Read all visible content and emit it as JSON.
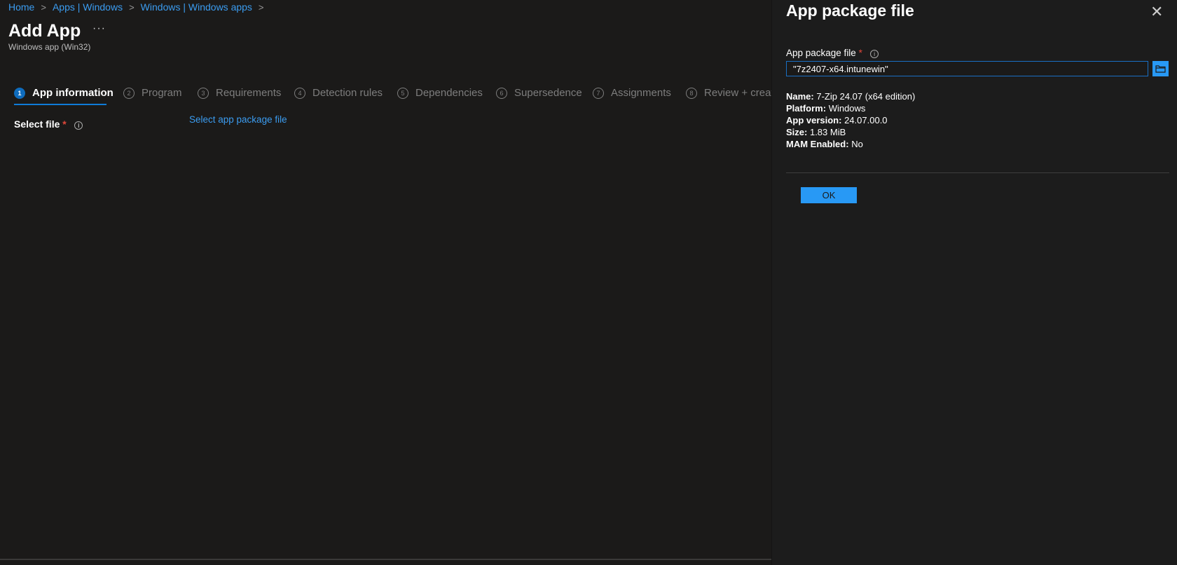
{
  "breadcrumb": [
    "Home",
    "Apps | Windows",
    "Windows | Windows apps"
  ],
  "header": {
    "title": "Add App",
    "more": "···",
    "subtitle": "Windows app (Win32)"
  },
  "steps": [
    {
      "num": "1",
      "label": "App information"
    },
    {
      "num": "2",
      "label": "Program"
    },
    {
      "num": "3",
      "label": "Requirements"
    },
    {
      "num": "4",
      "label": "Detection rules"
    },
    {
      "num": "5",
      "label": "Dependencies"
    },
    {
      "num": "6",
      "label": "Supersedence"
    },
    {
      "num": "7",
      "label": "Assignments"
    },
    {
      "num": "8",
      "label": "Review + create"
    }
  ],
  "form": {
    "select_file_label": "Select file",
    "required": "*",
    "info": "i",
    "select_link": "Select app package file"
  },
  "panel": {
    "title": "App package file",
    "close": "✕",
    "field_label": "App package file",
    "required": "*",
    "info": "i",
    "field_value": "\"7z2407-x64.intunewin\"",
    "details": [
      {
        "key": "Name:",
        "value": "7-Zip 24.07 (x64 edition)"
      },
      {
        "key": "Platform:",
        "value": "Windows"
      },
      {
        "key": "App version:",
        "value": "24.07.00.0"
      },
      {
        "key": "Size:",
        "value": "1.83 MiB"
      },
      {
        "key": "MAM Enabled:",
        "value": "No"
      }
    ],
    "ok": "OK"
  }
}
